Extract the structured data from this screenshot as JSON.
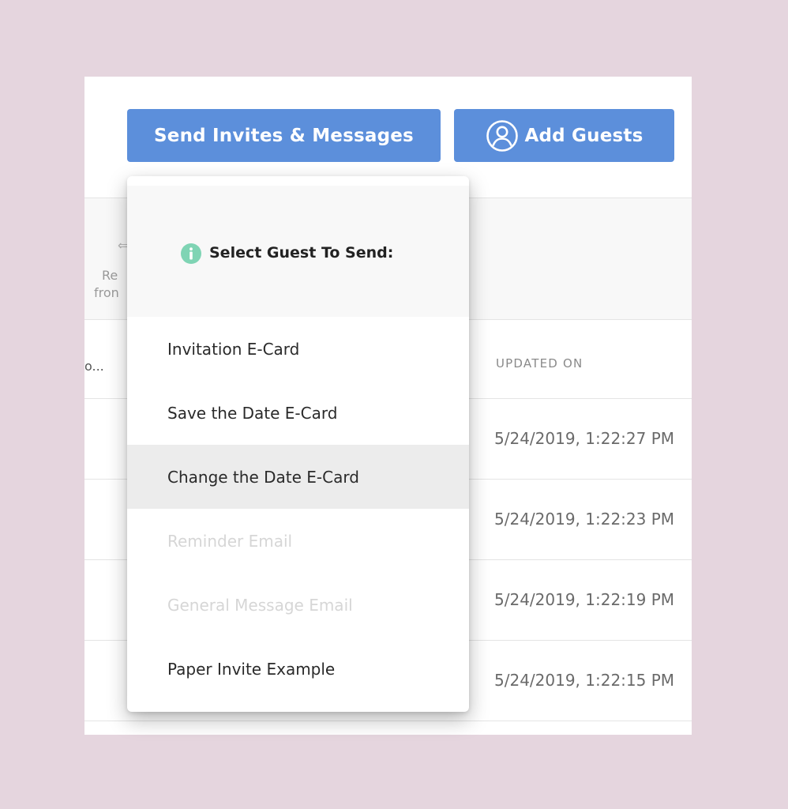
{
  "toolbar": {
    "send_label": "Send Invites & Messages",
    "add_guests_label": "Add Guests",
    "button_color": "#5c8fdb"
  },
  "background_table": {
    "remove_column_fragment": [
      "Re",
      "fron"
    ],
    "header_truncated": "o...",
    "updated_on_header": "UPDATED ON",
    "rows": [
      {
        "updated_on": "5/24/2019, 1:22:27 PM"
      },
      {
        "updated_on": "5/24/2019, 1:22:23 PM"
      },
      {
        "updated_on": "5/24/2019, 1:22:19 PM"
      },
      {
        "updated_on": "5/24/2019, 1:22:15 PM"
      }
    ]
  },
  "dropdown": {
    "header_icon": "info-icon",
    "header_icon_color": "#7fd4b4",
    "header_text": "Select Guest To Send:",
    "items": [
      {
        "label": "Invitation E-Card",
        "state": "enabled"
      },
      {
        "label": "Save the Date E-Card",
        "state": "enabled"
      },
      {
        "label": "Change the Date E-Card",
        "state": "hover"
      },
      {
        "label": "Reminder Email",
        "state": "disabled"
      },
      {
        "label": "General Message Email",
        "state": "disabled"
      },
      {
        "label": "Paper Invite Example",
        "state": "enabled"
      }
    ]
  }
}
